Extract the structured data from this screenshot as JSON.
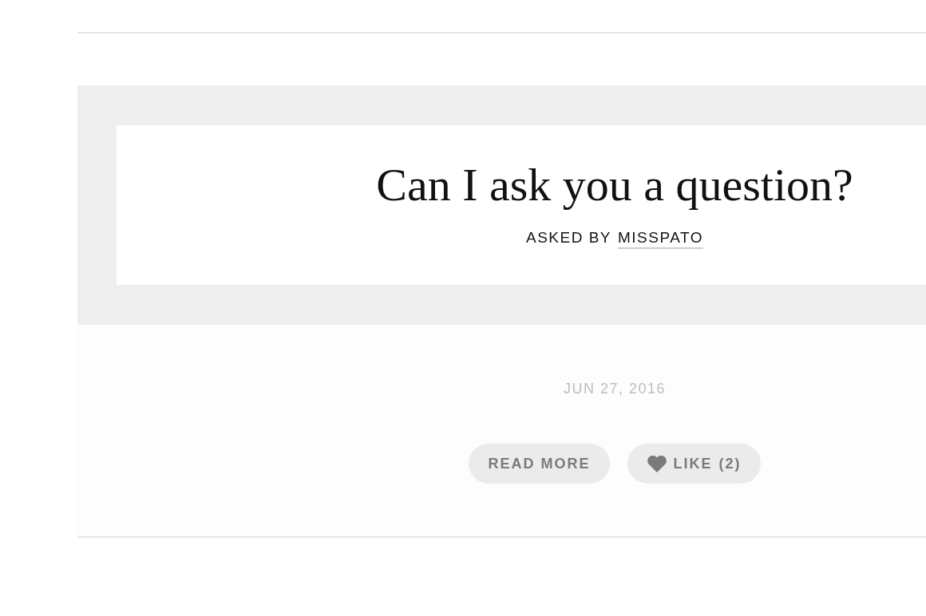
{
  "post": {
    "title": "Can I ask you a question?",
    "byline": "ASKED BY",
    "author": "MISSPATO",
    "date": "JUN 27, 2016"
  },
  "actions": {
    "read_more": "READ MORE",
    "like": {
      "label": "LIKE",
      "count": "(2)"
    }
  }
}
